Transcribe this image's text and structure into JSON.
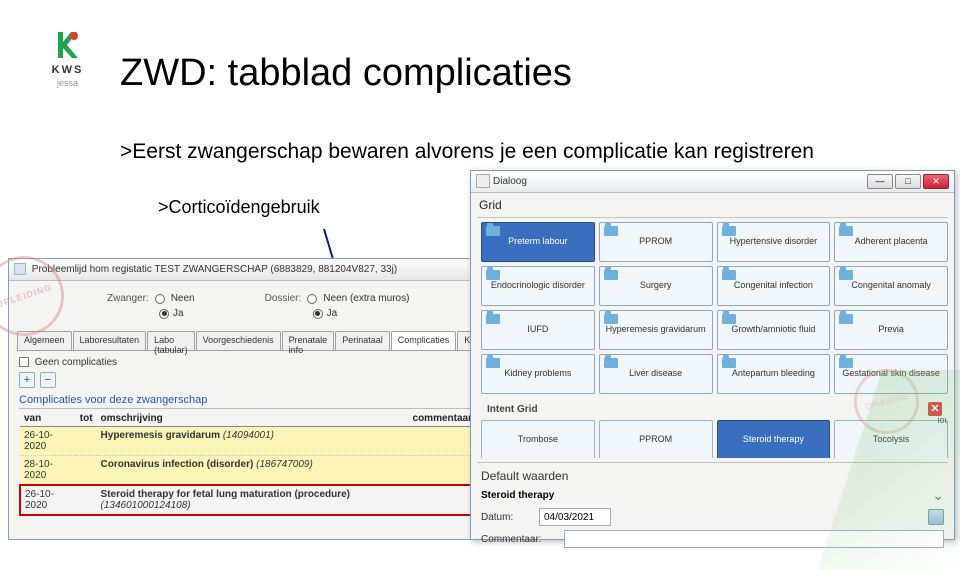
{
  "logo": {
    "brand": "KWS",
    "sub": "jessa"
  },
  "title": "ZWD: tabblad complicaties",
  "bullet1": ">Eerst zwangerschap bewaren alvorens je een complicatie kan registreren",
  "bullet2": ">Corticoïdengebruik",
  "left": {
    "window_title": "Probleemlijd hom registatic   TEST ZWANGERSCHAP (6883829, 881204V827, 33j)",
    "stamp": "OPLEIDING",
    "radio_groups": {
      "zwanger": {
        "label": "Zwanger:",
        "opt_neen": "Neen",
        "opt_ja": "Ja"
      },
      "dossier": {
        "label": "Dossier:",
        "opt_neen": "Neen (extra muros)",
        "opt_ja": "Ja"
      }
    },
    "tabs": [
      "Algemeen",
      "Laboresultaten",
      "Labo (tabular)",
      "Voorgeschiedenis",
      "Prenatale info",
      "Perinataal",
      "Complicaties",
      "KI"
    ],
    "active_tab": "Complicaties",
    "chk_none": "Geen complicaties",
    "subheader": "Complicaties voor deze zwangerschap",
    "cols": {
      "van": "van",
      "tot": "tot",
      "omschrijving": "omschrijving",
      "commentaar": "commentaar"
    },
    "rows": [
      {
        "van": "26-10-2020",
        "tot": "",
        "desc": "Hyperemesis gravidarum",
        "code": "(14094001)",
        "hl": "yellow"
      },
      {
        "van": "28-10-2020",
        "tot": "",
        "desc": "Coronavirus infection (disorder)",
        "code": "(186747009)",
        "hl": "yellow"
      },
      {
        "van": "26-10-2020",
        "tot": "",
        "desc": "Steroid therapy for fetal lung maturation (procedure)",
        "code": "(134601000124108)",
        "hl": "red"
      }
    ]
  },
  "right": {
    "window_title": "Dialoog",
    "grid_label": "Grid",
    "categories": [
      [
        "Preterm labour",
        "PPROM",
        "Hypertensive disorder",
        "Adherent placenta"
      ],
      [
        "Endocrinologic disorder",
        "Surgery",
        "Congenital infection",
        "Congenital anomaly"
      ],
      [
        "IUFD",
        "Hyperemesis gravidarum",
        "Growth/amniotic fluid",
        "Previa"
      ],
      [
        "Kidney problems",
        "Liver disease",
        "Antepartum bleeding",
        "Gestational skin disease"
      ]
    ],
    "intent_header": "Intent Grid",
    "intent_row": [
      "Trombose",
      "PPROM",
      "Steroid therapy",
      "Tocolysis"
    ],
    "intent_selected": "Steroid therapy",
    "partial_right": "ious",
    "defaults_label": "Default waarden",
    "steroid_label": "Steroid therapy",
    "date_label": "Datum:",
    "date_value": "04/03/2021",
    "comment_label": "Commentaar:",
    "stamp": "OPLEIDING"
  }
}
